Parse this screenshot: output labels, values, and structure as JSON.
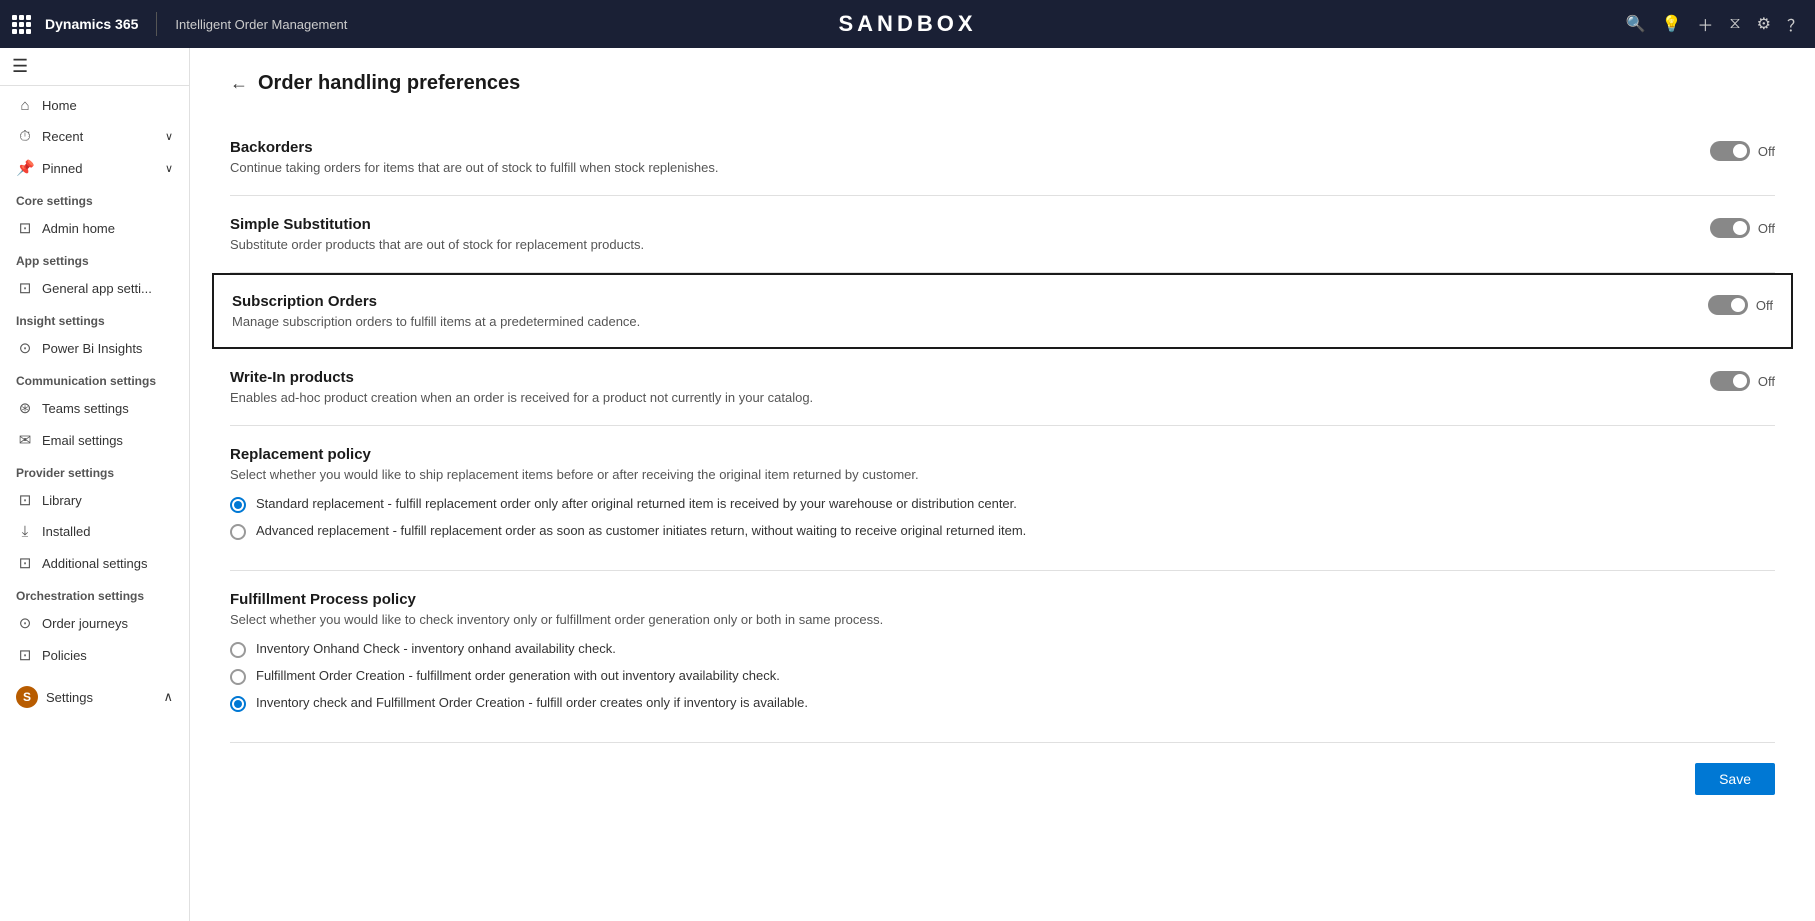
{
  "topbar": {
    "logo": "Dynamics 365",
    "divider": true,
    "app_name": "Intelligent Order Management",
    "sandbox_label": "SANDBOX",
    "icons": [
      "search",
      "bulb",
      "plus",
      "filter",
      "settings",
      "question"
    ]
  },
  "sidebar": {
    "hamburger": "☰",
    "nav_items": [
      {
        "id": "home",
        "icon": "⌂",
        "label": "Home",
        "has_chevron": false
      },
      {
        "id": "recent",
        "icon": "🕐",
        "label": "Recent",
        "has_chevron": true
      },
      {
        "id": "pinned",
        "icon": "📌",
        "label": "Pinned",
        "has_chevron": true
      }
    ],
    "sections": [
      {
        "header": "Core settings",
        "items": [
          {
            "id": "admin-home",
            "icon": "⊡",
            "label": "Admin home"
          }
        ]
      },
      {
        "header": "App settings",
        "items": [
          {
            "id": "general-app",
            "icon": "⊡",
            "label": "General app setti..."
          }
        ]
      },
      {
        "header": "Insight settings",
        "items": [
          {
            "id": "power-bi",
            "icon": "⊙",
            "label": "Power Bi Insights"
          }
        ]
      },
      {
        "header": "Communication settings",
        "items": [
          {
            "id": "teams",
            "icon": "⊛",
            "label": "Teams settings"
          },
          {
            "id": "email",
            "icon": "⊡",
            "label": "Email settings"
          }
        ]
      },
      {
        "header": "Provider settings",
        "items": [
          {
            "id": "library",
            "icon": "⊡",
            "label": "Library"
          },
          {
            "id": "installed",
            "icon": "⊡",
            "label": "Installed"
          },
          {
            "id": "additional",
            "icon": "⊡",
            "label": "Additional settings"
          }
        ]
      },
      {
        "header": "Orchestration settings",
        "items": [
          {
            "id": "order-journeys",
            "icon": "⊙",
            "label": "Order journeys"
          },
          {
            "id": "policies",
            "icon": "⊡",
            "label": "Policies"
          }
        ]
      }
    ],
    "bottom_item": {
      "badge": "S",
      "label": "Settings",
      "has_chevron": true
    }
  },
  "page": {
    "back_arrow": "←",
    "title": "Order handling preferences",
    "settings": [
      {
        "id": "backorders",
        "title": "Backorders",
        "description": "Continue taking orders for items that are out of stock to fulfill when stock replenishes.",
        "toggle_state": "Off",
        "highlighted": false
      },
      {
        "id": "simple-substitution",
        "title": "Simple Substitution",
        "description": "Substitute order products that are out of stock for replacement products.",
        "toggle_state": "Off",
        "highlighted": false
      },
      {
        "id": "subscription-orders",
        "title": "Subscription Orders",
        "description": "Manage subscription orders to fulfill items at a predetermined cadence.",
        "toggle_state": "Off",
        "highlighted": true
      },
      {
        "id": "write-in-products",
        "title": "Write-In products",
        "description": "Enables ad-hoc product creation when an order is received for a product not currently in your catalog.",
        "toggle_state": "Off",
        "highlighted": false
      }
    ],
    "replacement_policy": {
      "title": "Replacement policy",
      "description": "Select whether you would like to ship replacement items before or after receiving the original item returned by customer.",
      "options": [
        {
          "id": "standard-replacement",
          "label": "Standard replacement - fulfill replacement order only after original returned item is received by your warehouse or distribution center.",
          "selected": true
        },
        {
          "id": "advanced-replacement",
          "label": "Advanced replacement - fulfill replacement order as soon as customer initiates return, without waiting to receive original returned item.",
          "selected": false
        }
      ]
    },
    "fulfillment_policy": {
      "title": "Fulfillment Process policy",
      "description": "Select whether you would like to check inventory only or fulfillment order generation only or both in same process.",
      "options": [
        {
          "id": "inventory-onhand",
          "label": "Inventory Onhand Check - inventory onhand availability check.",
          "selected": false
        },
        {
          "id": "fulfillment-order-creation",
          "label": "Fulfillment Order Creation - fulfillment order generation with out inventory availability check.",
          "selected": false
        },
        {
          "id": "inventory-and-fulfillment",
          "label": "Inventory check and Fulfillment Order Creation - fulfill order creates only if inventory is available.",
          "selected": true
        }
      ]
    },
    "save_button_label": "Save"
  }
}
